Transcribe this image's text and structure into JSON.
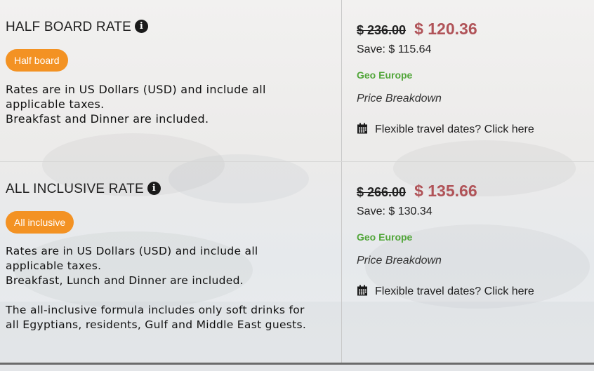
{
  "rates": [
    {
      "title": "HALF BOARD RATE",
      "badge": "Half board",
      "description": [
        "Rates are in US Dollars (USD) and include all applicable taxes.\nBreakfast and Dinner are included."
      ],
      "old_price": "$ 236.00",
      "new_price": "$ 120.36",
      "save": "Save: $ 115.64",
      "provider": "Geo Europe",
      "breakdown_link": "Price Breakdown",
      "flexible_dates": "Flexible travel dates? Click here"
    },
    {
      "title": "ALL INCLUSIVE RATE",
      "badge": "All inclusive",
      "description": [
        "Rates are in US Dollars (USD) and include all applicable taxes.\nBreakfast, Lunch and Dinner are included.",
        "The all-inclusive formula includes only soft drinks for all Egyptians, residents, Gulf and Middle East guests."
      ],
      "old_price": "$ 266.00",
      "new_price": "$ 135.66",
      "save": "Save: $ 130.34",
      "provider": "Geo Europe",
      "breakdown_link": "Price Breakdown",
      "flexible_dates": "Flexible travel dates? Click here"
    }
  ],
  "colors": {
    "badge": "#f39223",
    "new_price": "#b05358",
    "provider": "#52a63a"
  },
  "icons": {
    "info": "info-circle-icon",
    "calendar": "calendar-icon"
  }
}
